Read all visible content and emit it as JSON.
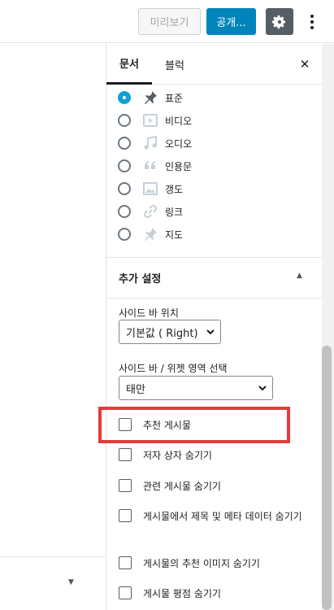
{
  "toolbar": {
    "preview_label": "미리보기",
    "publish_label": "공개...",
    "settings_icon": "gear-icon",
    "more_icon": "more-vertical-icon"
  },
  "tabs": {
    "document": "문서",
    "block": "블럭",
    "close_icon": "close-icon"
  },
  "post_formats": [
    {
      "label": "표준",
      "icon": "pin-icon",
      "checked": true
    },
    {
      "label": "비디오",
      "icon": "video-icon",
      "checked": false
    },
    {
      "label": "오디오",
      "icon": "audio-icon",
      "checked": false
    },
    {
      "label": "인용문",
      "icon": "quote-icon",
      "checked": false
    },
    {
      "label": "갱도",
      "icon": "gallery-icon",
      "checked": false
    },
    {
      "label": "링크",
      "icon": "link-icon",
      "checked": false
    },
    {
      "label": "지도",
      "icon": "pin-icon",
      "checked": false
    }
  ],
  "extra_settings": {
    "title": "추가 설정",
    "sidebar_position_label": "사이드 바 위치",
    "sidebar_position_value": "기본값 ( Right)",
    "sidebar_widget_label": "사이드 바 / 위젯 영역 선택",
    "sidebar_widget_value": "태만",
    "checkboxes": [
      {
        "label": "추천 게시물",
        "checked": false
      },
      {
        "label": "저자 상자 숨기기",
        "checked": false
      },
      {
        "label": "관련 게시물 숨기기",
        "checked": false
      },
      {
        "label": "게시물에서 제목 및 메타 데이터 숨기기",
        "checked": false
      },
      {
        "label": "게시물의 추천 이미지 숨기기",
        "checked": false
      },
      {
        "label": "게시물 평점 숨기기",
        "checked": false
      }
    ]
  },
  "colors": {
    "accent": "#0085ba",
    "highlight": "#e33b3b",
    "radio_checked": "#11a0d2"
  }
}
